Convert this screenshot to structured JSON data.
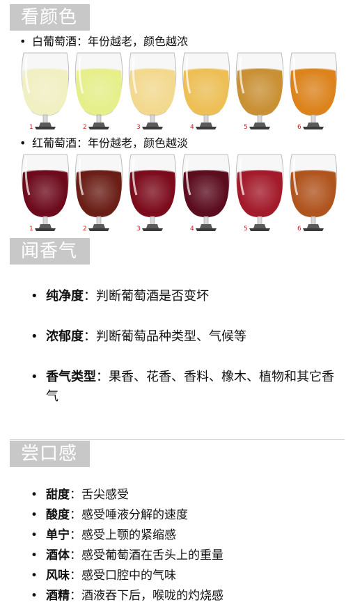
{
  "sections": {
    "look": "看颜色",
    "smell": "闻香气",
    "taste": "尝口感"
  },
  "white": {
    "bullet": "•",
    "title": "白葡萄酒：年份越老，颜色越浓",
    "glasses": [
      {
        "n": "1",
        "color": "#f1f0c2"
      },
      {
        "n": "2",
        "color": "#e6ef8a"
      },
      {
        "n": "3",
        "color": "#f3d98e"
      },
      {
        "n": "4",
        "color": "#edbf55"
      },
      {
        "n": "5",
        "color": "#c99034"
      },
      {
        "n": "6",
        "color": "#dc831c"
      }
    ]
  },
  "red": {
    "bullet": "•",
    "title": "红葡萄酒：年份越老，颜色越淡",
    "glasses": [
      {
        "n": "1",
        "color": "#6d0a1c"
      },
      {
        "n": "2",
        "color": "#6a1e16"
      },
      {
        "n": "3",
        "color": "#7c0b1c"
      },
      {
        "n": "4",
        "color": "#5b0c1e"
      },
      {
        "n": "5",
        "color": "#a31a2a"
      },
      {
        "n": "6",
        "color": "#b0541e"
      }
    ]
  },
  "aroma": [
    {
      "bullet": "•",
      "label": "纯净度",
      "sep": "：",
      "text": "判断葡萄酒是否变坏"
    },
    {
      "bullet": "•",
      "label": "浓郁度",
      "sep": "：",
      "text": "判断葡萄品种类型、气候等"
    },
    {
      "bullet": "•",
      "label": "香气类型",
      "sep": "：",
      "text": "果香、花香、香料、橡木、植物和其它香气"
    }
  ],
  "taste": [
    {
      "bullet": "•",
      "label": "甜度",
      "sep": "：",
      "text": "舌尖感受"
    },
    {
      "bullet": "•",
      "label": "酸度",
      "sep": "：",
      "text": "感受唾液分解的速度"
    },
    {
      "bullet": "•",
      "label": "单宁",
      "sep": "：",
      "text": "感受上颚的紧缩感"
    },
    {
      "bullet": "•",
      "label": "酒体",
      "sep": "：",
      "text": "感受葡萄酒在舌头上的重量"
    },
    {
      "bullet": "•",
      "label": "风味",
      "sep": "：",
      "text": "感受口腔中的气味"
    },
    {
      "bullet": "•",
      "label": "酒精",
      "sep": "：",
      "text": "酒液吞下后，喉咙的灼烧感"
    }
  ]
}
